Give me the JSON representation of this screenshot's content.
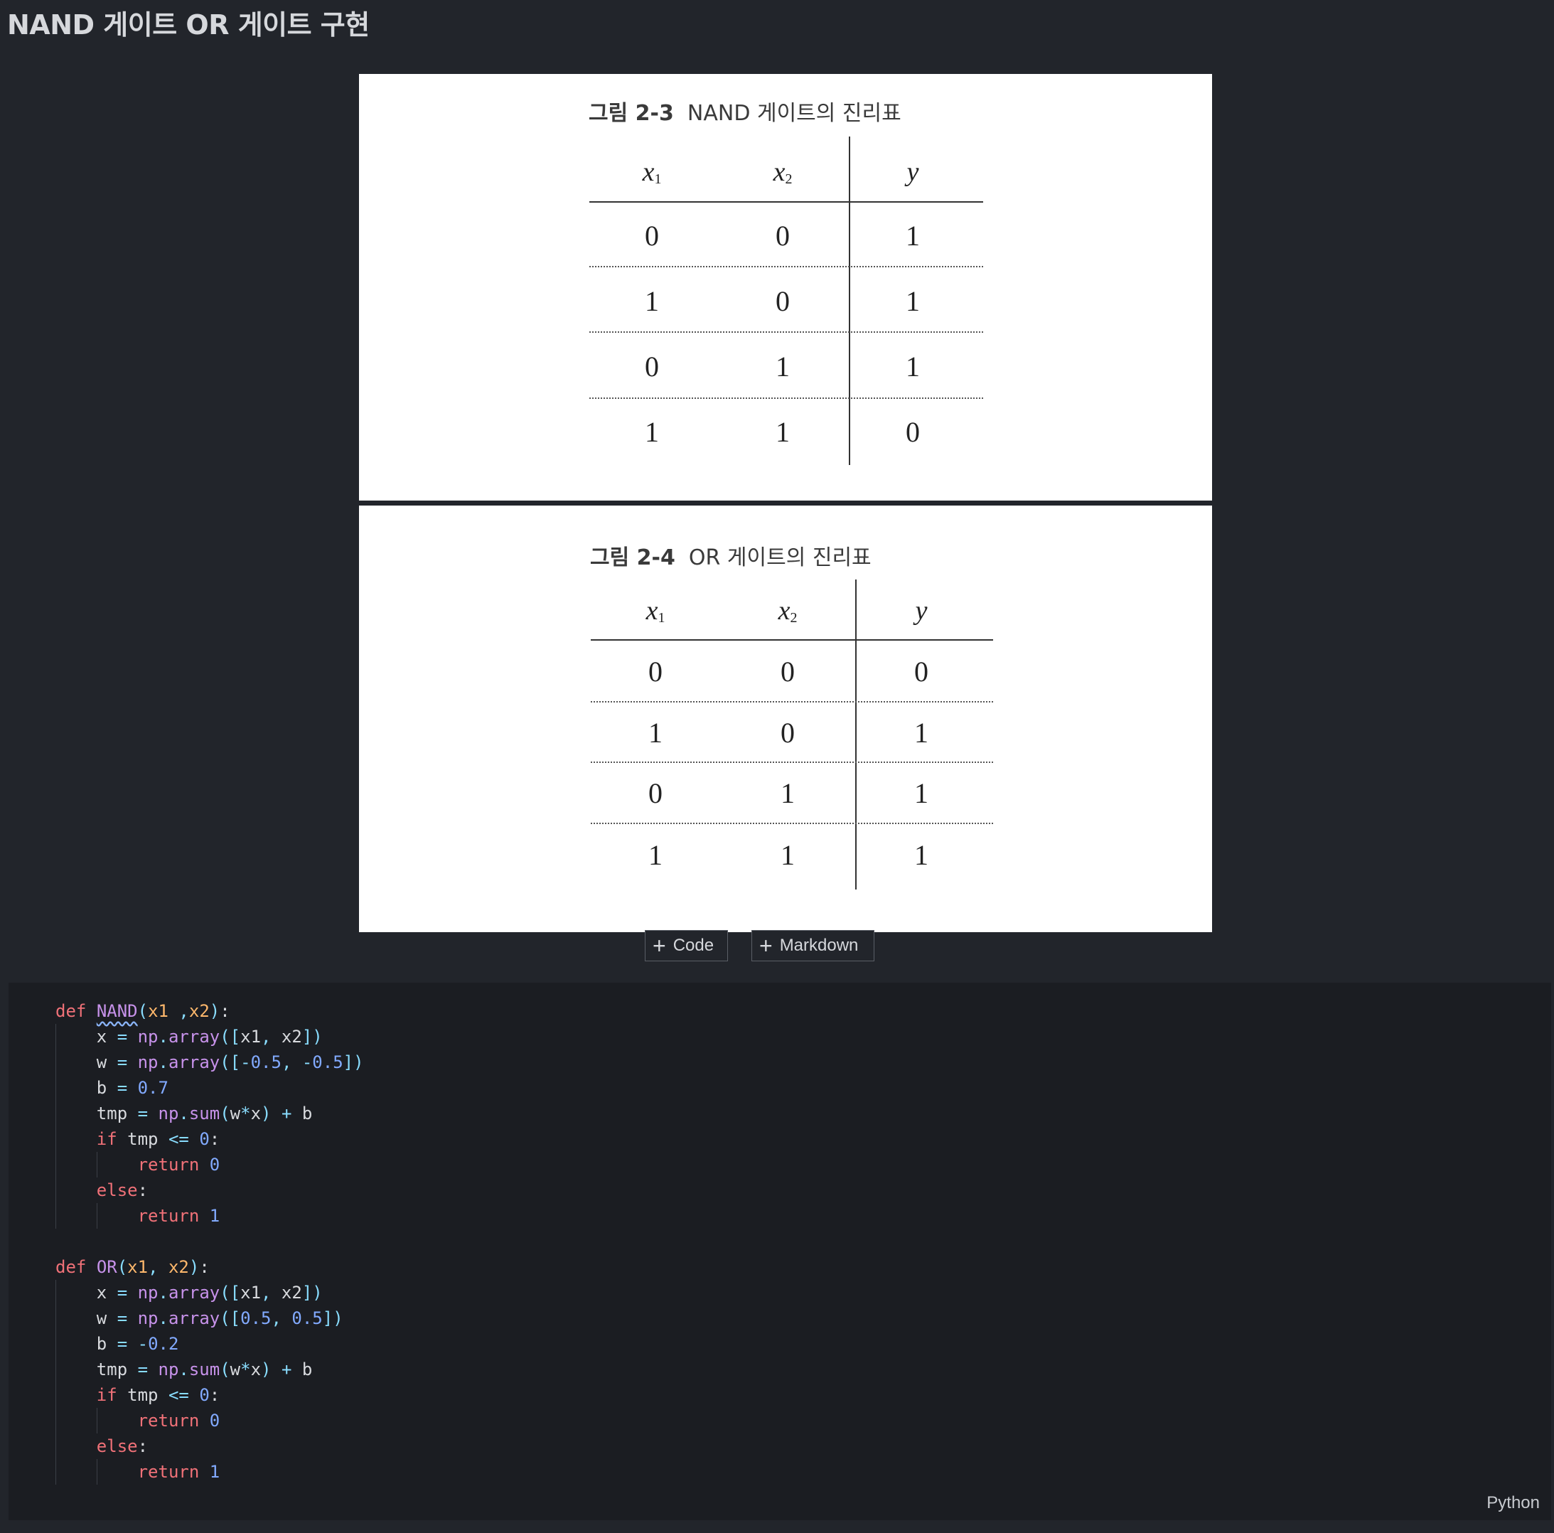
{
  "cell_heading": "NAND 게이트 OR 게이트 구현",
  "figures": [
    {
      "caption_num": "그림 2-3",
      "caption_text": "NAND 게이트의 진리표",
      "headers": {
        "x1": "x",
        "x1_sub": "1",
        "x2": "x",
        "x2_sub": "2",
        "y": "y"
      },
      "rows": [
        [
          "0",
          "0",
          "1"
        ],
        [
          "1",
          "0",
          "1"
        ],
        [
          "0",
          "1",
          "1"
        ],
        [
          "1",
          "1",
          "0"
        ]
      ]
    },
    {
      "caption_num": "그림 2-4",
      "caption_text": "OR 게이트의 진리표",
      "headers": {
        "x1": "x",
        "x1_sub": "1",
        "x2": "x",
        "x2_sub": "2",
        "y": "y"
      },
      "rows": [
        [
          "0",
          "0",
          "0"
        ],
        [
          "1",
          "0",
          "1"
        ],
        [
          "0",
          "1",
          "1"
        ],
        [
          "1",
          "1",
          "1"
        ]
      ]
    }
  ],
  "toolbar": {
    "add_code_label": "Code",
    "add_markdown_label": "Markdown"
  },
  "code_cell": {
    "language": "Python",
    "lines": [
      "def NAND(x1 ,x2):",
      "    x = np.array([x1, x2])",
      "    w = np.array([-0.5, -0.5])",
      "    b = 0.7",
      "    tmp = np.sum(w*x) + b",
      "    if tmp <= 0:",
      "        return 0",
      "    else:",
      "        return 1",
      "",
      "def OR(x1, x2):",
      "    x = np.array([x1, x2])",
      "    w = np.array([0.5, 0.5])",
      "    b = -0.2",
      "    tmp = np.sum(w*x) + b",
      "    if tmp <= 0:",
      "        return 0",
      "    else:",
      "        return 1"
    ]
  }
}
